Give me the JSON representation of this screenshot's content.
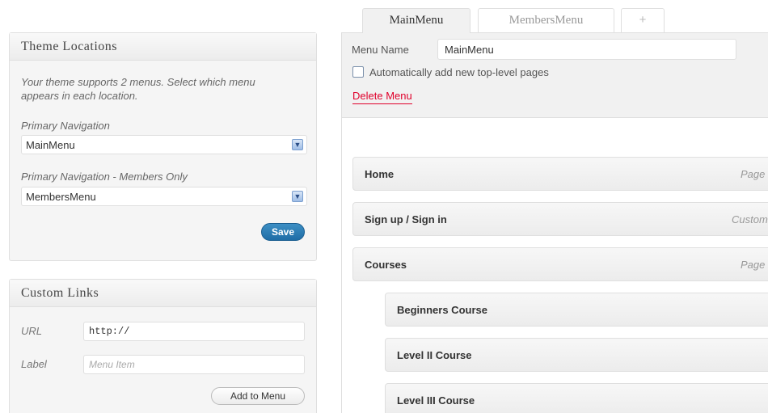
{
  "theme_locations": {
    "title": "Theme Locations",
    "description": "Your theme supports 2 menus. Select which menu appears in each location.",
    "locations": [
      {
        "label": "Primary Navigation",
        "selected": "MainMenu"
      },
      {
        "label": "Primary Navigation - Members Only",
        "selected": "MembersMenu"
      }
    ],
    "save_label": "Save",
    "arrow_glyph": "▼"
  },
  "custom_links": {
    "title": "Custom Links",
    "url_label": "URL",
    "url_value": "http://",
    "label_label": "Label",
    "label_placeholder": "Menu Item",
    "add_label": "Add to Menu"
  },
  "tabs": [
    {
      "label": "MainMenu",
      "active": true
    },
    {
      "label": "MembersMenu",
      "active": false
    },
    {
      "label": "+",
      "active": false
    }
  ],
  "menu_editor": {
    "name_label": "Menu Name",
    "name_value": "MainMenu",
    "auto_add_label": "Automatically add new top-level pages",
    "auto_add_checked": false,
    "delete_label": "Delete Menu"
  },
  "menu_items": [
    {
      "title": "Home",
      "type": "Page"
    },
    {
      "title": "Sign up / Sign in",
      "type": "Custom"
    },
    {
      "title": "Courses",
      "type": "Page"
    },
    {
      "title": "Beginners Course",
      "type": ""
    },
    {
      "title": "Level II Course",
      "type": ""
    },
    {
      "title": "Level III Course",
      "type": ""
    }
  ],
  "colors": {
    "accent_blue": "#21759b",
    "delete_red": "#e0002b"
  }
}
